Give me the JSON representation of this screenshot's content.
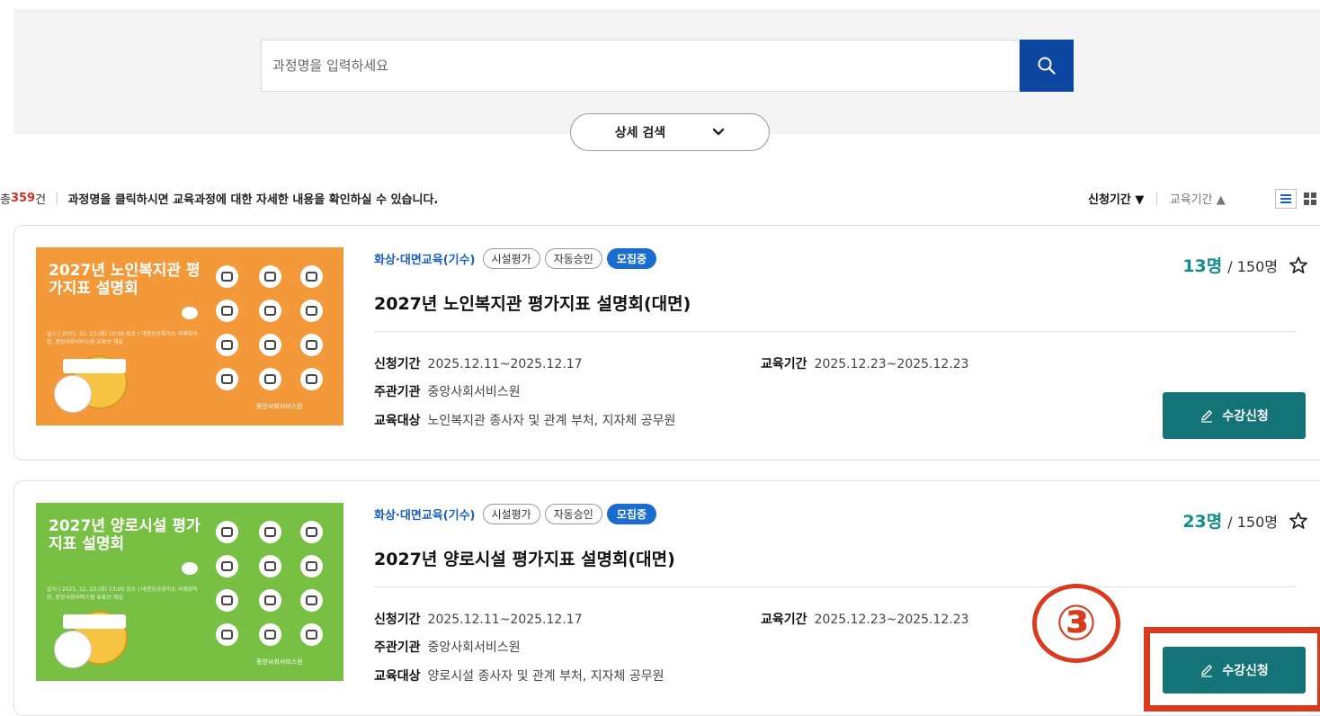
{
  "search": {
    "placeholder": "과정명을 입력하세요",
    "detail_toggle_label": "상세 검색"
  },
  "summary": {
    "total_prefix": "총 ",
    "total_count": "359",
    "total_suffix": "건",
    "guide": "과정명을 클릭하시면 교육과정에 대한 자세한 내용을 확인하실 수 있습니다."
  },
  "sort": {
    "application_period": "신청기간 ▼",
    "education_period": "교육기간 ▲"
  },
  "labels": {
    "application_period": "신청기간",
    "education_period": "교육기간",
    "organizer": "주관기관",
    "target": "교육대상"
  },
  "courses": [
    {
      "type": "화상·대면교육(기수)",
      "tags": [
        "시설평가",
        "자동승인"
      ],
      "status": "모집중",
      "title": "2027년 노인복지관 평가지표 설명회(대면)",
      "application_period": "2025.12.11~2025.12.17",
      "education_period": "2025.12.23~2025.12.23",
      "organizer": "중앙사회서비스원",
      "target": "노인복지관 종사자 및 관계 부처, 지자체 공무원",
      "enrolled": "13명",
      "capacity": "/ 150명",
      "apply_label": "수강신청",
      "thumb": {
        "bg": "#f3993a",
        "title": "2027년 노인복지관 평가지표 설명회",
        "fine_print": "일시 | 2025. 12. 23.(화) 10:00 장소 | 대한상공회의소 국제회의장, 중앙사회서비스원 유튜브 채널",
        "logo": "중앙사회서비스원"
      }
    },
    {
      "type": "화상·대면교육(기수)",
      "tags": [
        "시설평가",
        "자동승인"
      ],
      "status": "모집중",
      "title": "2027년 양로시설 평가지표 설명회(대면)",
      "application_period": "2025.12.11~2025.12.17",
      "education_period": "2025.12.23~2025.12.23",
      "organizer": "중앙사회서비스원",
      "target": "양로시설 종사자 및 관계 부처, 지자체 공무원",
      "enrolled": "23명",
      "capacity": "/ 150명",
      "apply_label": "수강신청",
      "thumb": {
        "bg": "#77c043",
        "title": "2027년 양로시설 평가지표 설명회",
        "fine_print": "일시 | 2025. 12. 23.(화) 13:00 장소 | 대한상공회의소 국제회의장, 중앙사회서비스원 유튜브 채널",
        "logo": "중앙사회서비스원"
      }
    }
  ],
  "annotation": {
    "marker": "③",
    "color": "#d93b1e"
  },
  "icons": {
    "search": "search-icon",
    "chevron": "chevron-down-icon",
    "list_view": "list-view-icon",
    "grid_view": "grid-view-icon",
    "star": "star-outline-icon",
    "pencil": "pencil-icon"
  },
  "colors": {
    "primary_blue": "#0d47a1",
    "teal_button": "#137377",
    "count_teal": "#138c8c",
    "status_blue": "#1a6ccf",
    "count_red": "#d0312d"
  }
}
